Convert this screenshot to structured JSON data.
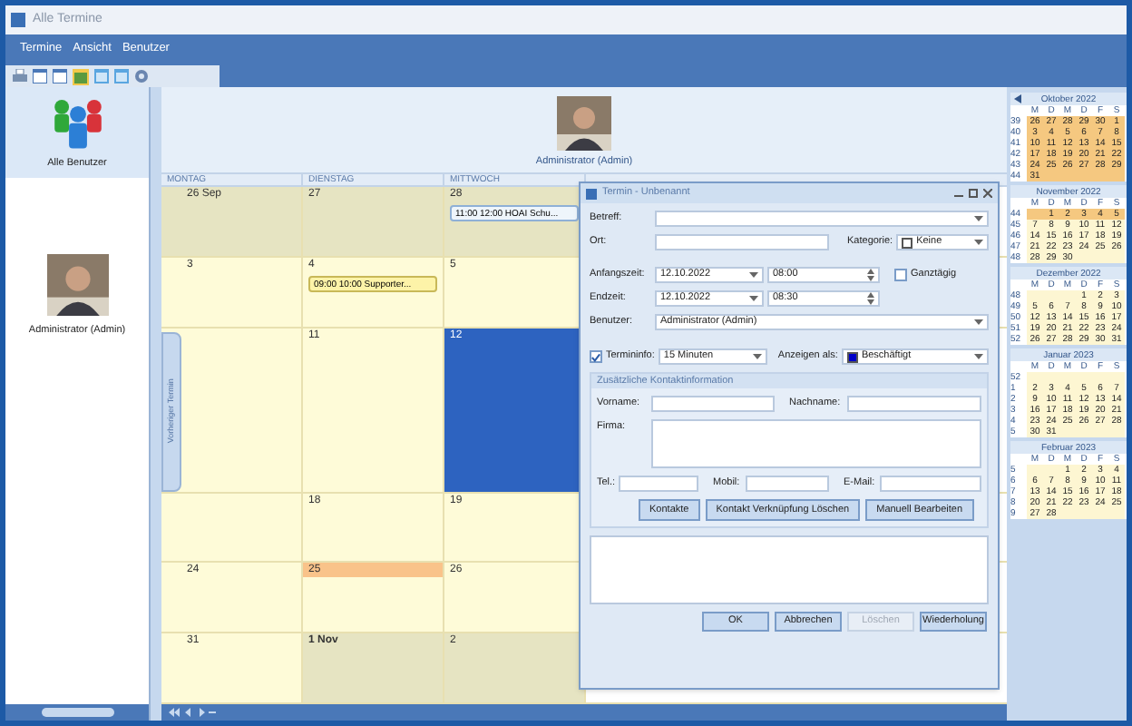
{
  "window": {
    "title": "Alle Termine"
  },
  "menu": [
    "Termine",
    "Ansicht",
    "Benutzer"
  ],
  "users": [
    {
      "name": "Alle Benutzer",
      "kind": "group",
      "selected": true
    },
    {
      "name": "Administrator (Admin)",
      "kind": "person",
      "selected": false
    }
  ],
  "calendar": {
    "user": "Administrator (Admin)",
    "columns": [
      "MONTAG",
      "DIENSTAG",
      "MITTWOCH"
    ],
    "weeks": [
      [
        {
          "date": "26 Sep",
          "kind": "other_month",
          "selected": false,
          "bold": false
        },
        {
          "date": "27",
          "kind": "other_month",
          "selected": false,
          "bold": false
        },
        {
          "date": "28",
          "kind": "other_month",
          "selected": false,
          "bold": false,
          "events": [
            "11:00 12:00 HOAI Schu..."
          ]
        }
      ],
      [
        {
          "date": "3",
          "kind": "current",
          "selected": false,
          "bold": false
        },
        {
          "date": "4",
          "kind": "current",
          "selected": false,
          "bold": false,
          "events": [
            "09:00 10:00 Supporter..."
          ]
        },
        {
          "date": "5",
          "kind": "current",
          "selected": false,
          "bold": false
        }
      ],
      [
        {
          "kind": "current",
          "selected": false
        },
        {
          "date": "11",
          "kind": "current",
          "selected": false,
          "bold": false
        },
        {
          "date": "12",
          "kind": "current",
          "selected": true,
          "bold": false
        }
      ],
      [
        {
          "kind": "current",
          "selected": false
        },
        {
          "date": "18",
          "kind": "current",
          "selected": false,
          "bold": false
        },
        {
          "date": "19",
          "kind": "current",
          "selected": false,
          "bold": false
        }
      ],
      [
        {
          "date": "24",
          "kind": "current",
          "selected": false,
          "bold": false
        },
        {
          "date": "25",
          "kind": "today",
          "selected": false,
          "bold": false
        },
        {
          "date": "26",
          "kind": "current",
          "selected": false,
          "bold": false
        }
      ],
      [
        {
          "date": "31",
          "kind": "current",
          "selected": false,
          "bold": false
        },
        {
          "date": "1 Nov",
          "kind": "other_month",
          "selected": false,
          "bold": true
        },
        {
          "date": "2",
          "kind": "other_month",
          "selected": false,
          "bold": false
        }
      ]
    ]
  },
  "side_tab": "Vorheriger Termin",
  "dialog": {
    "title": "Termin - Unbenannt",
    "betreff": {
      "label": "Betreff:"
    },
    "ort": {
      "label": "Ort:"
    },
    "kategorie": {
      "label": "Kategorie:",
      "value": "Keine",
      "color": "#ffffff"
    },
    "anfangszeit": {
      "label": "Anfangszeit:",
      "date": "12.10.2022",
      "time": "08:00"
    },
    "ganztaegig": {
      "label": "Ganztägig",
      "checked": false
    },
    "endzeit": {
      "label": "Endzeit:",
      "date": "12.10.2022",
      "time": "08:30"
    },
    "benutzer": {
      "label": "Benutzer:",
      "value": "Administrator (Admin)"
    },
    "erinnerung": {
      "label": "Termininfo:",
      "checked": true,
      "value": "15 Minuten"
    },
    "anzeigen_als": {
      "label": "Anzeigen als:",
      "value": "Beschäftigt",
      "color": "#0000c8"
    },
    "kontakt": {
      "title": "Zusätzliche Kontaktinformation",
      "vorname": "Vorname:",
      "nachname": "Nachname:",
      "firma": "Firma:",
      "tel": "Tel.:",
      "mobil": "Mobil:",
      "email": "E-Mail:",
      "buttons": [
        "Kontakte",
        "Kontakt Verknüpfung Löschen",
        "Manuell Bearbeiten"
      ]
    },
    "buttons": [
      {
        "label": "OK",
        "disabled": false
      },
      {
        "label": "Abbrechen",
        "disabled": false
      },
      {
        "label": "Löschen",
        "disabled": true
      },
      {
        "label": "Wiederholung",
        "disabled": false
      }
    ]
  },
  "mini_calendars": [
    {
      "title": "Oktober 2022",
      "weekdays": [
        "M",
        "D",
        "M",
        "D",
        "F",
        "S"
      ],
      "weeks": [
        {
          "week": "39",
          "in_view": true,
          "days": [
            "26",
            "27",
            "28",
            "29",
            "30",
            "1"
          ]
        },
        {
          "week": "40",
          "in_view": true,
          "days": [
            "3",
            "4",
            "5",
            "6",
            "7",
            "8"
          ]
        },
        {
          "week": "41",
          "in_view": true,
          "days": [
            "10",
            "11",
            "12",
            "13",
            "14",
            "15"
          ]
        },
        {
          "week": "42",
          "in_view": true,
          "days": [
            "17",
            "18",
            "19",
            "20",
            "21",
            "22"
          ]
        },
        {
          "week": "43",
          "in_view": true,
          "days": [
            "24",
            "25",
            "26",
            "27",
            "28",
            "29"
          ]
        },
        {
          "week": "44",
          "in_view": true,
          "days": [
            "31"
          ]
        }
      ]
    },
    {
      "title": "November 2022",
      "weekdays": [
        "M",
        "D",
        "M",
        "D",
        "F",
        "S"
      ],
      "weeks": [
        {
          "week": "44",
          "in_view": true,
          "days": [
            "1",
            "2",
            "3",
            "4",
            "5"
          ]
        },
        {
          "week": "45",
          "in_view": false,
          "days": [
            "7",
            "8",
            "9",
            "10",
            "11",
            "12"
          ]
        },
        {
          "week": "46",
          "in_view": false,
          "days": [
            "14",
            "15",
            "16",
            "17",
            "18",
            "19"
          ]
        },
        {
          "week": "47",
          "in_view": false,
          "days": [
            "21",
            "22",
            "23",
            "24",
            "25",
            "26"
          ]
        },
        {
          "week": "48",
          "in_view": false,
          "days": [
            "28",
            "29",
            "30"
          ]
        }
      ]
    },
    {
      "title": "Dezember 2022",
      "weekdays": [
        "M",
        "D",
        "M",
        "D",
        "F",
        "S"
      ],
      "weeks": [
        {
          "week": "48",
          "in_view": false,
          "days": [
            "1",
            "2",
            "3"
          ]
        },
        {
          "week": "49",
          "in_view": false,
          "days": [
            "5",
            "6",
            "7",
            "8",
            "9",
            "10"
          ]
        },
        {
          "week": "50",
          "in_view": false,
          "days": [
            "12",
            "13",
            "14",
            "15",
            "16",
            "17"
          ]
        },
        {
          "week": "51",
          "in_view": false,
          "days": [
            "19",
            "20",
            "21",
            "22",
            "23",
            "24"
          ]
        },
        {
          "week": "52",
          "in_view": false,
          "days": [
            "26",
            "27",
            "28",
            "29",
            "30",
            "31"
          ]
        }
      ]
    },
    {
      "title": "Januar 2023",
      "weekdays": [
        "M",
        "D",
        "M",
        "D",
        "F",
        "S"
      ],
      "weeks": [
        {
          "week": "52",
          "in_view": false
        },
        {
          "week": "1",
          "in_view": false,
          "days": [
            "2",
            "3",
            "4",
            "5",
            "6",
            "7"
          ]
        },
        {
          "week": "2",
          "in_view": false,
          "days": [
            "9",
            "10",
            "11",
            "12",
            "13",
            "14"
          ]
        },
        {
          "week": "3",
          "in_view": false,
          "days": [
            "16",
            "17",
            "18",
            "19",
            "20",
            "21"
          ]
        },
        {
          "week": "4",
          "in_view": false,
          "days": [
            "23",
            "24",
            "25",
            "26",
            "27",
            "28"
          ]
        },
        {
          "week": "5",
          "in_view": false,
          "days": [
            "30",
            "31"
          ]
        }
      ]
    },
    {
      "title": "Februar 2023",
      "weekdays": [
        "M",
        "D",
        "M",
        "D",
        "F",
        "S"
      ],
      "weeks": [
        {
          "week": "5",
          "in_view": false,
          "days": [
            "1",
            "2",
            "3",
            "4"
          ]
        },
        {
          "week": "6",
          "in_view": false,
          "days": [
            "6",
            "7",
            "8",
            "9",
            "10",
            "11"
          ]
        },
        {
          "week": "7",
          "in_view": false,
          "days": [
            "13",
            "14",
            "15",
            "16",
            "17",
            "18"
          ]
        },
        {
          "week": "8",
          "in_view": false,
          "days": [
            "20",
            "21",
            "22",
            "23",
            "24",
            "25"
          ]
        },
        {
          "week": "9",
          "in_view": false,
          "days": [
            "27",
            "28"
          ]
        }
      ]
    }
  ]
}
